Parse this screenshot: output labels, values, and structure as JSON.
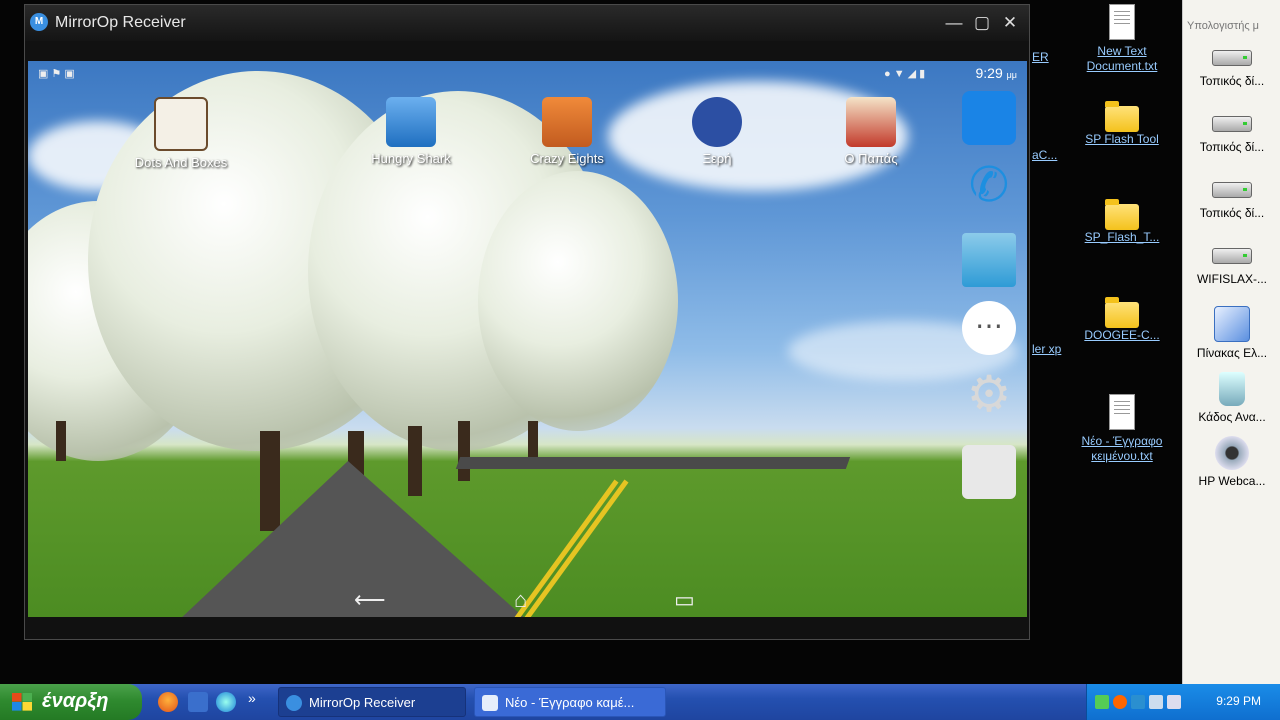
{
  "window": {
    "title": "MirrorOp Receiver",
    "logo": "M",
    "minimize_icon": "minimize-icon",
    "maximize_icon": "maximize-icon",
    "close_icon": "close-icon"
  },
  "android": {
    "clock": "9:29",
    "clock_suffix": "μμ",
    "apps": [
      {
        "name": "Dots And Boxes",
        "color": "#6b4b2c"
      },
      {
        "name": "Hungry Shark",
        "color": "#2f7fd1"
      },
      {
        "name": "Crazy Eights",
        "color": "#c25b1f"
      },
      {
        "name": "Ξερή",
        "color": "#2c4fa3"
      },
      {
        "name": "Ο Παπάς",
        "color": "#c23a2b"
      }
    ],
    "dock": [
      {
        "icon": "maxthon-icon",
        "color": "#1a84e6"
      },
      {
        "icon": "phone-icon",
        "color": "#1d8fe0"
      },
      {
        "icon": "contacts-icon",
        "color": "#2e9bd6"
      },
      {
        "icon": "app-drawer-icon",
        "color": "#ffffff"
      },
      {
        "icon": "settings-icon",
        "color": "#c8c8c8"
      },
      {
        "icon": "camera-icon",
        "color": "#e0e0e0"
      }
    ],
    "nav": {
      "back": "⟵",
      "home": "⌂",
      "recents": "▭"
    }
  },
  "desktop": {
    "icons": [
      {
        "label": "New Text Document.txt"
      },
      {
        "label": "SP Flash Tool"
      },
      {
        "label": "SP_Flash_T..."
      },
      {
        "label": "DOOGEE-C..."
      },
      {
        "label": "Νέο - Έγγραφο κειμένου.txt"
      }
    ],
    "partial_labels": [
      "ER",
      "aC...",
      "ler xp"
    ]
  },
  "side_panel": {
    "title": "Υπολογιστής μ",
    "drives": [
      {
        "label": "Τοπικός δί..."
      },
      {
        "label": "Τοπικός δί..."
      },
      {
        "label": "Τοπικός δί..."
      },
      {
        "label": "WIFISLAX-..."
      },
      {
        "label": "Πίνακας Ελ..."
      },
      {
        "label": "Κάδος Ανα..."
      },
      {
        "label": "HP Webca..."
      }
    ]
  },
  "taskbar": {
    "start_label": "έναρξη",
    "tasks": [
      {
        "label": "MirrorOp Receiver",
        "active": true
      },
      {
        "label": "Νέο - Έγγραφο καμέ...",
        "active": false
      }
    ],
    "overflow": "»",
    "clock": "9:29 PM"
  }
}
